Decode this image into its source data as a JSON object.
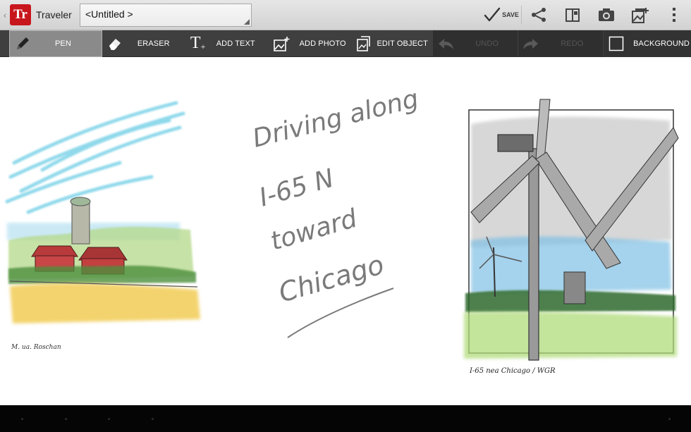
{
  "app": {
    "name": "Traveler",
    "logo_text": "Tr",
    "up_caret": "‹",
    "notebook_title": "<Untitled >"
  },
  "actions": {
    "save_label": "SAVE",
    "icons": [
      "share-icon",
      "page-layout-icon",
      "camera-icon",
      "add-image-icon",
      "overflow-menu-icon"
    ]
  },
  "tools": {
    "pen": "PEN",
    "eraser": "ERASER",
    "add_text": "ADD TEXT",
    "add_photo": "ADD PHOTO",
    "edit_object": "EDIT OBJECT",
    "undo": "UNDO",
    "redo": "REDO",
    "background": "BACKGROUND"
  },
  "canvas": {
    "handwriting": [
      "Driving along",
      "I-65 N",
      "toward",
      "Chicago"
    ],
    "left_signature": "M. ua. Roschan",
    "right_signature": "I-65 nea Chicago / WGR"
  },
  "colors": {
    "brand_red": "#c8161d",
    "toolbar_bg": "#3f3f3f",
    "active_tool": "#8a8a8a"
  }
}
